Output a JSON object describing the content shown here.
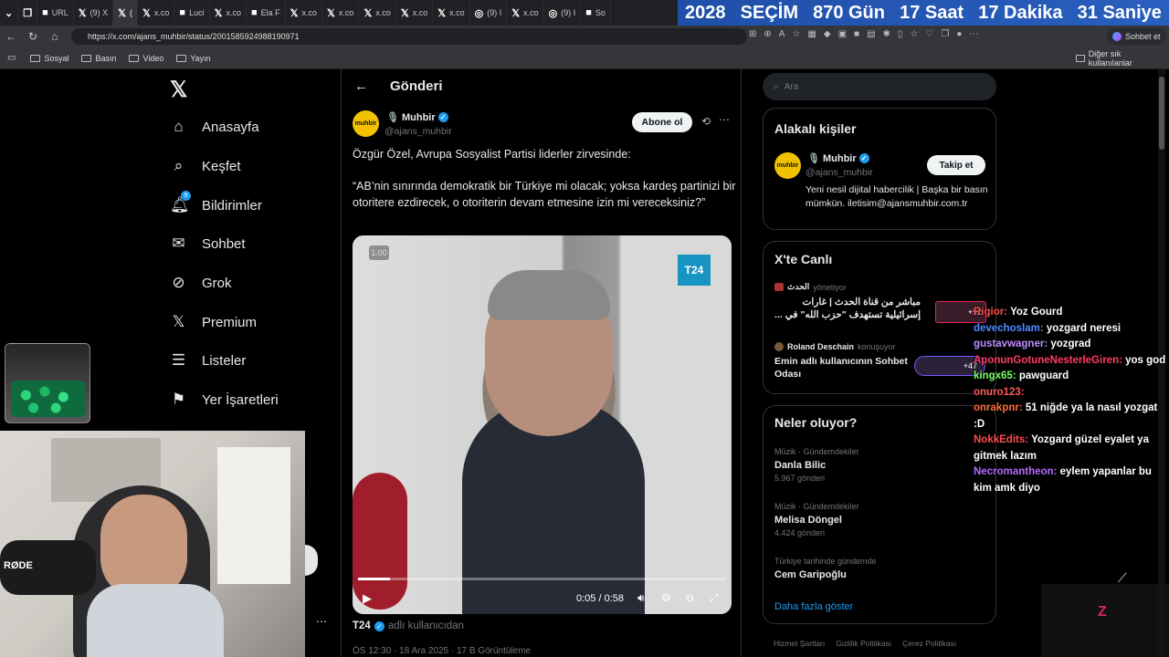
{
  "tabs": [
    {
      "label": "",
      "icon": "chevron-down-icon"
    },
    {
      "label": "",
      "icon": "workspaces-icon"
    },
    {
      "label": "URL",
      "icon": "page-icon"
    },
    {
      "label": "(9) X",
      "icon": "x-icon"
    },
    {
      "label": "(",
      "icon": "x-icon",
      "active": true
    },
    {
      "label": "x.co",
      "icon": "x-icon"
    },
    {
      "label": "Luci",
      "icon": "page-icon"
    },
    {
      "label": "x.co",
      "icon": "x-icon"
    },
    {
      "label": "Ela F",
      "icon": "page-icon"
    },
    {
      "label": "x.co",
      "icon": "x-icon"
    },
    {
      "label": "x.co",
      "icon": "x-icon"
    },
    {
      "label": "x.co",
      "icon": "x-icon"
    },
    {
      "label": "x.co",
      "icon": "x-icon"
    },
    {
      "label": "x.co",
      "icon": "x-icon"
    },
    {
      "label": "(9) I",
      "icon": "instagram-icon"
    },
    {
      "label": "x.co",
      "icon": "x-icon"
    },
    {
      "label": "(9) I",
      "icon": "instagram-icon"
    },
    {
      "label": "So",
      "icon": "page-icon"
    }
  ],
  "countdown": [
    "2028",
    "SEÇİM",
    "870 Gün",
    "17 Saat",
    "17 Dakika",
    "31 Saniye"
  ],
  "url": "https://x.com/ajans_muhbir/status/2001585924988190971",
  "profile_button": "Sohbet et",
  "bookmarks": [
    "Sosyal",
    "Basın",
    "Video",
    "Yayın"
  ],
  "bookmarks_other": "Diğer sık kullanılanlar",
  "nav": {
    "items": [
      "Anasayfa",
      "Keşfet",
      "Bildirimler",
      "Sohbet",
      "Grok",
      "Premium",
      "Listeler",
      "Yer İşaretleri"
    ],
    "notif_badge": "9"
  },
  "post": {
    "header": "Gönderi",
    "author_name": "Muhbir",
    "author_handle": "@ajans_muhbir",
    "avatar_text": "muhbir",
    "subscribe": "Abone ol",
    "text1": "Özgür Özel, Avrupa Sosyalist Partisi liderler zirvesinde:",
    "text2": "“AB’nin sınırında demokratik bir Türkiye mi olacak; yoksa kardeş partinizi bir otoritere ezdirecek, o otoriterin devam etmesine izin mi vereceksiniz?”",
    "speed": "1.00",
    "watermark": "T24",
    "time": "0:05 / 0:58",
    "source_name": "T24",
    "source_suffix": "adlı kullanıcıdan",
    "footer": "ÖS 12:30 · 18 Ara 2025 · 17 B Görüntüleme",
    "progress": 0.086
  },
  "search_placeholder": "Ara",
  "related": {
    "title": "Alakalı kişiler",
    "name": "Muhbir",
    "handle": "@ajans_muhbir",
    "follow": "Takip et",
    "bio": "Yeni nesil dijital habercilik | Başka bir basın mümkün. iletisim@ajansmuhbir.com.tr"
  },
  "live": {
    "title": "X'te Canlı",
    "items": [
      {
        "host": "الحدث",
        "role": "yönetiyor",
        "text": "مباشر من قناة الحدث | غارات إسرائيلية تستهدف \"حزب الله\" في ...",
        "extra": "+92"
      },
      {
        "host": "Roland Deschain",
        "role": "konuşuyor",
        "text": "Emin adlı kullanıcının Sohbet Odası",
        "extra": "+47"
      }
    ]
  },
  "trends": {
    "title": "Neler oluyor?",
    "items": [
      {
        "context": "Müzik · Gündemdekiler",
        "name": "Danla Bilic",
        "count": "5.967 gönderi"
      },
      {
        "context": "Müzik · Gündemdekiler",
        "name": "Melisa Döngel",
        "count": "4.424 gönderi"
      },
      {
        "context": "Türkiye tarihinde gündemde",
        "name": "Cem Garipoğlu",
        "count": ""
      }
    ],
    "more": "Daha fazla göster"
  },
  "footer_links": [
    "Hizmet Şartları",
    "Gizlilik Politikası",
    "Çerez Politikası"
  ],
  "chat": [
    {
      "user": "Rigior",
      "text": "Yoz Gourd",
      "color": "#ff4d4d"
    },
    {
      "user": "devechoslam",
      "text": "yozgard neresi",
      "color": "#4d8cff"
    },
    {
      "user": "gustavwagner",
      "text": "yozgrad",
      "color": "#c08cff"
    },
    {
      "user": "AponunGotuneNesterleGiren",
      "text": "yos god",
      "color": "#ff3b6b"
    },
    {
      "user": "kingx65",
      "text": "pawguard",
      "color": "#7dff6b"
    },
    {
      "user": "onuro123",
      "text": "",
      "color": "#ff5a5a"
    },
    {
      "user": "onrakpnr",
      "text": "51 niğde ya la nasıl yozgat :D",
      "color": "#ff6b3b"
    },
    {
      "user": "NokkEdits",
      "text": "Yozgard güzel eyalet ya gitmek lazım",
      "color": "#ff4d4d"
    },
    {
      "user": "Necromantheon",
      "text": "eylem yapanlar bu kim amk diyo",
      "color": "#b56bff"
    }
  ],
  "webcam_mic_label": "RØDE"
}
